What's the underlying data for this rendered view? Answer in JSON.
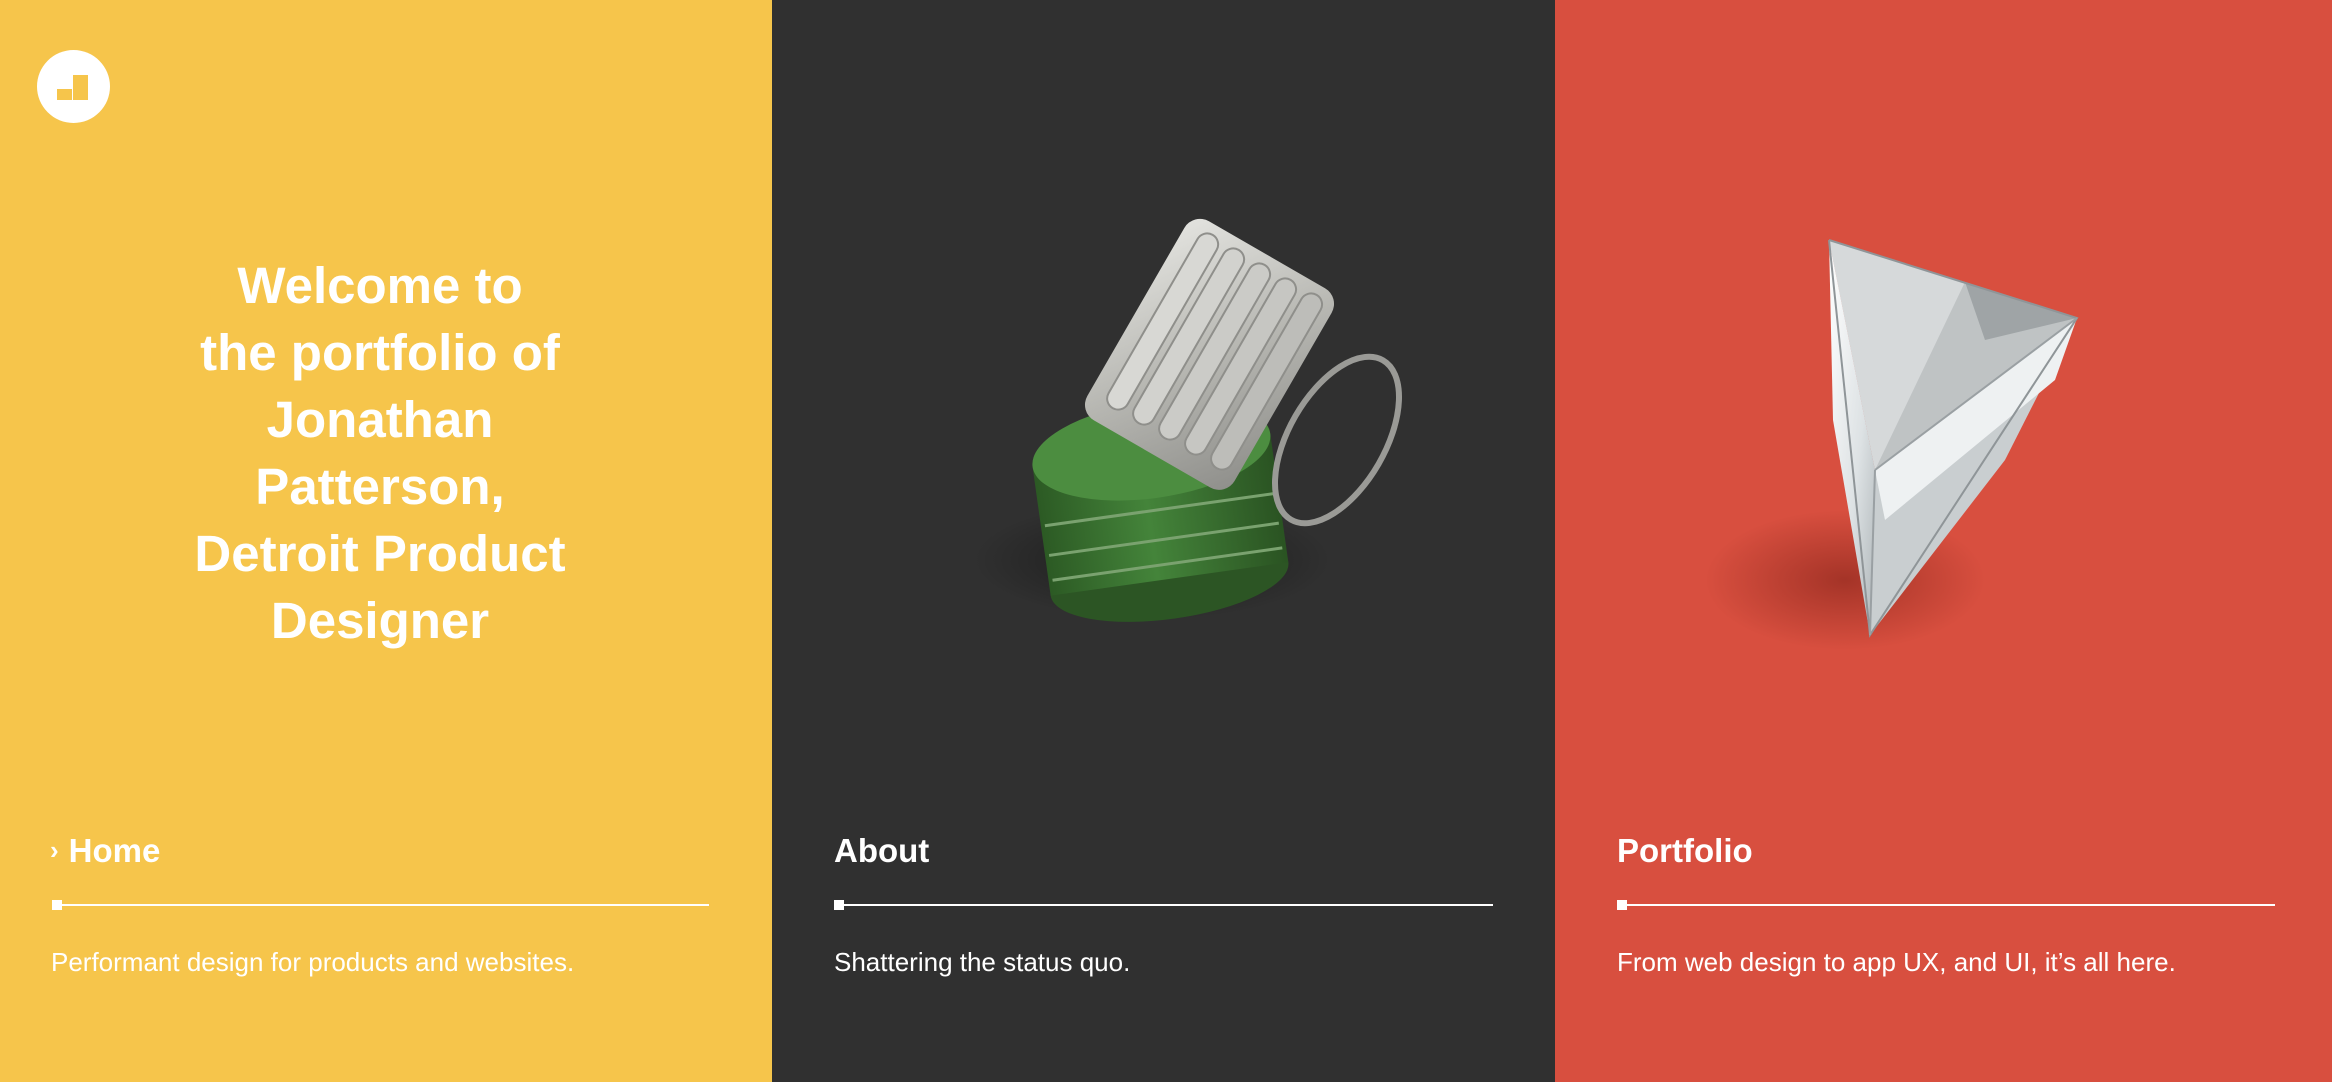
{
  "colors": {
    "home_bg": "#f6c54b",
    "about_bg": "#303030",
    "portfolio_bg": "#d84f3f",
    "text": "#ffffff",
    "grenade_green": "#3f7a35",
    "metal": "#c8c8c4",
    "prism_glass": "#eceff1"
  },
  "logo": {
    "icon": "logo-mark-icon"
  },
  "hero": {
    "lines": [
      "Welcome to",
      "the portfolio of",
      "Jonathan",
      "Patterson,",
      "Detroit Product",
      "Designer"
    ]
  },
  "nav": [
    {
      "key": "home",
      "chevron": "›",
      "label": "Home",
      "description": "Performant design for products and websites.",
      "active": true
    },
    {
      "key": "about",
      "label": "About",
      "description": "Shattering the status quo.",
      "image": "grenade-icon"
    },
    {
      "key": "portfolio",
      "label": "Portfolio",
      "description": "From web design to app UX, and UI, it’s all here.",
      "image": "prism-icon"
    }
  ]
}
